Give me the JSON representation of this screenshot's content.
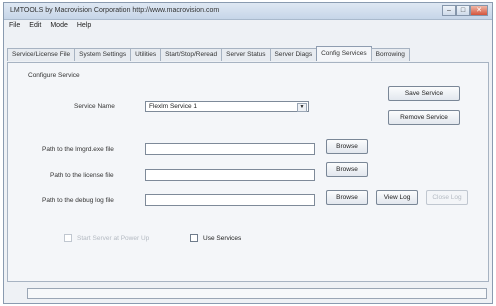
{
  "window": {
    "title": "LMTOOLS by Macrovision Corporation http://www.macrovision.com",
    "buttons": {
      "minimize": "–",
      "maximize": "□",
      "close": "✕"
    }
  },
  "menu": [
    "File",
    "Edit",
    "Mode",
    "Help"
  ],
  "tabs": [
    "Service/License File",
    "System Settings",
    "Utilities",
    "Start/Stop/Reread",
    "Server Status",
    "Server Diags",
    "Config Services",
    "Borrowing"
  ],
  "active_tab": "Config Services",
  "config": {
    "group_title": "Configure Service",
    "service_name_label": "Service Name",
    "service_name_value": "Flexlm Service 1",
    "lmgrd_label": "Path to the lmgrd.exe file",
    "license_label": "Path to the license file",
    "debug_label": "Path to the debug log file",
    "lmgrd_value": "",
    "license_value": "",
    "debug_value": "",
    "save_service": "Save Service",
    "remove_service": "Remove Service",
    "browse": "Browse",
    "view_log": "View Log",
    "close_log": "Close Log",
    "use_services": "Use Services",
    "start_at_power_up": "Start Server at Power Up"
  },
  "status": {
    "text": ""
  }
}
